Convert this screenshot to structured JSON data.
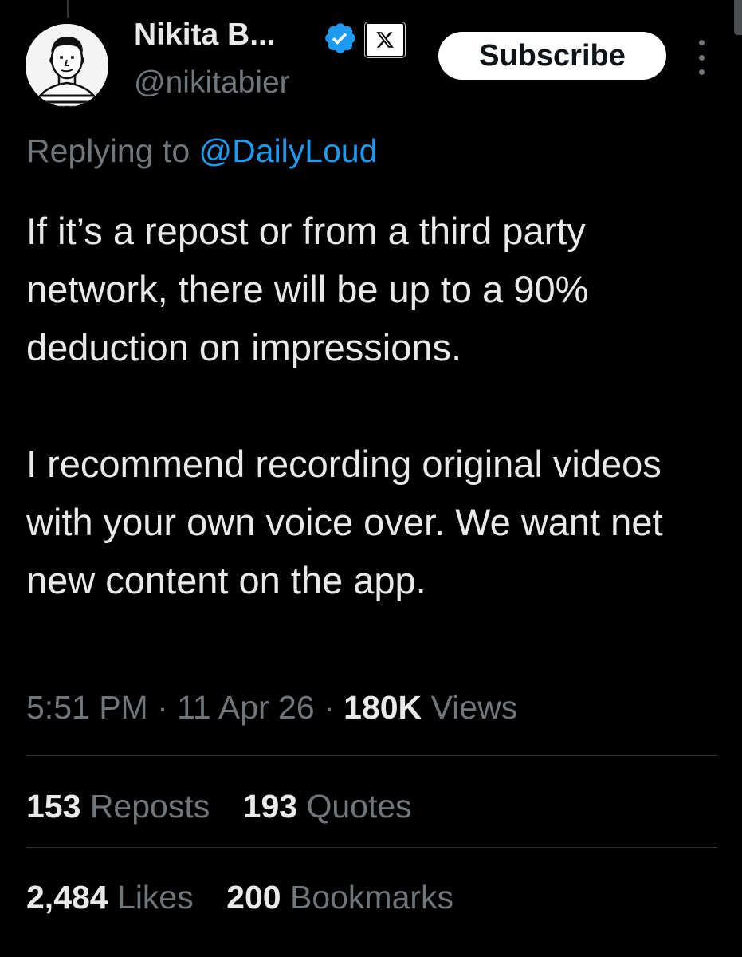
{
  "author": {
    "display_name": "Nikita B...",
    "handle": "@nikitabier",
    "verified": true,
    "verified_color": "#1d9bf0",
    "badge_icon": "x-logo-icon",
    "avatar_icon": "cartoon-portrait-avatar"
  },
  "actions": {
    "subscribe_label": "Subscribe",
    "more_icon": "vertical-ellipsis-icon"
  },
  "reply": {
    "prefix": "Replying to",
    "mention": "@DailyLoud"
  },
  "tweet": {
    "paragraphs": [
      "If it’s a repost or from a third party network, there will be up to a 90% deduction on impressions.",
      "I recommend recording original videos with your own voice over. We want net new content on the app."
    ]
  },
  "meta": {
    "time": "5:51 PM",
    "date": "11 Apr 26",
    "views_count": "180K",
    "views_label": "Views",
    "separator": "·"
  },
  "stats": {
    "reposts": {
      "count": "153",
      "label": "Reposts"
    },
    "quotes": {
      "count": "193",
      "label": "Quotes"
    },
    "likes": {
      "count": "2,484",
      "label": "Likes"
    },
    "bookmarks": {
      "count": "200",
      "label": "Bookmarks"
    }
  },
  "colors": {
    "background": "#000000",
    "primary_text": "#e7e9ea",
    "secondary_text": "#71767b",
    "link": "#1d9bf0",
    "divider": "#2f3336"
  }
}
